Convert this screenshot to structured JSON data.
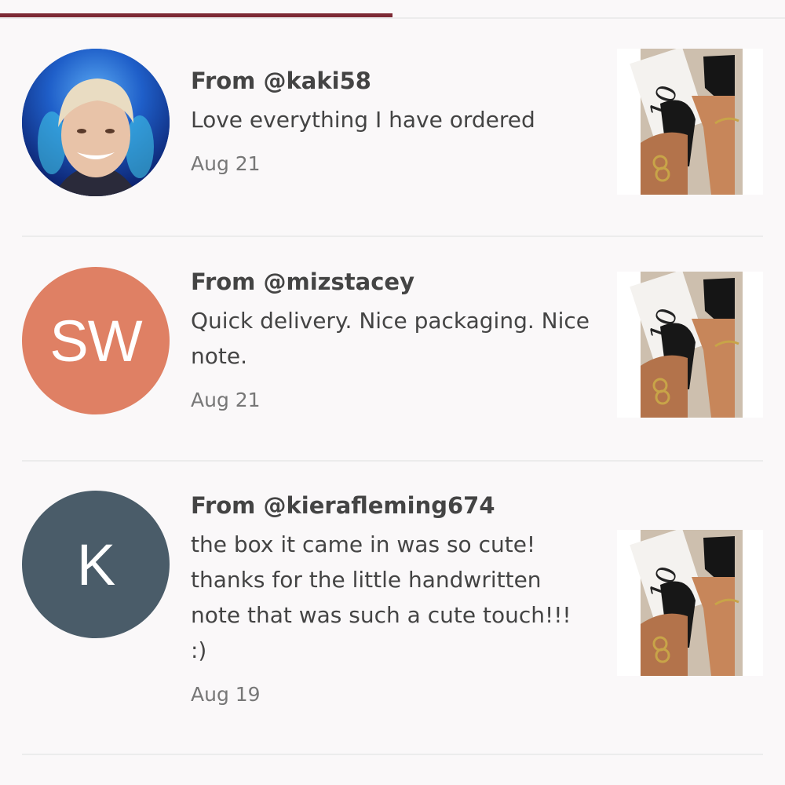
{
  "reviews": [
    {
      "from": "From @kaki58",
      "text": "Love everything I have ordered",
      "date": "Aug 21",
      "avatar": {
        "type": "photo"
      },
      "item_image": "black-sandals-photo"
    },
    {
      "from": "From @mizstacey",
      "text": "Quick delivery. Nice packaging. Nice note.",
      "date": "Aug 21",
      "avatar": {
        "type": "initials",
        "initials": "SW",
        "color": "#df8064"
      },
      "item_image": "black-sandals-photo"
    },
    {
      "from": "From @kierafleming674",
      "text": "the box it came in was so cute! thanks for the little handwritten note that was such a cute touch!!! :)",
      "date": "Aug 19",
      "avatar": {
        "type": "initials",
        "initials": "K",
        "color": "#4a5c69"
      },
      "item_image": "black-sandals-photo"
    }
  ],
  "colors": {
    "tab_indicator": "#7d2a35",
    "background": "#faf8f9",
    "divider": "#ececec"
  }
}
